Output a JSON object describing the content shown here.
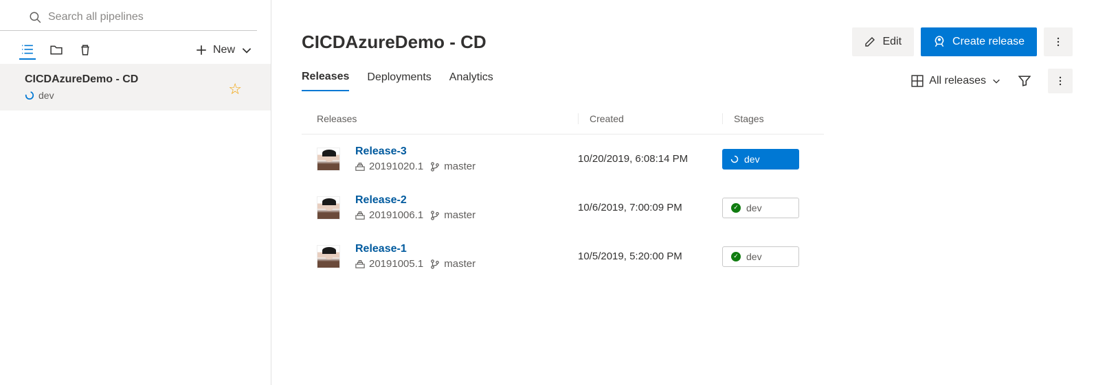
{
  "search": {
    "placeholder": "Search all pipelines"
  },
  "sidebar": {
    "new_label": "New",
    "pipeline": {
      "name": "CICDAzureDemo - CD",
      "env": "dev"
    }
  },
  "header": {
    "title": "CICDAzureDemo - CD",
    "edit": "Edit",
    "create": "Create release"
  },
  "tabs": {
    "releases": "Releases",
    "deployments": "Deployments",
    "analytics": "Analytics",
    "view_filter": "All releases"
  },
  "table": {
    "col_releases": "Releases",
    "col_created": "Created",
    "col_stages": "Stages"
  },
  "releases": [
    {
      "name": "Release-3",
      "build": "20191020.1",
      "branch": "master",
      "created": "10/20/2019, 6:08:14 PM",
      "stage": "dev",
      "stage_state": "active"
    },
    {
      "name": "Release-2",
      "build": "20191006.1",
      "branch": "master",
      "created": "10/6/2019, 7:00:09 PM",
      "stage": "dev",
      "stage_state": "success"
    },
    {
      "name": "Release-1",
      "build": "20191005.1",
      "branch": "master",
      "created": "10/5/2019, 5:20:00 PM",
      "stage": "dev",
      "stage_state": "success"
    }
  ]
}
